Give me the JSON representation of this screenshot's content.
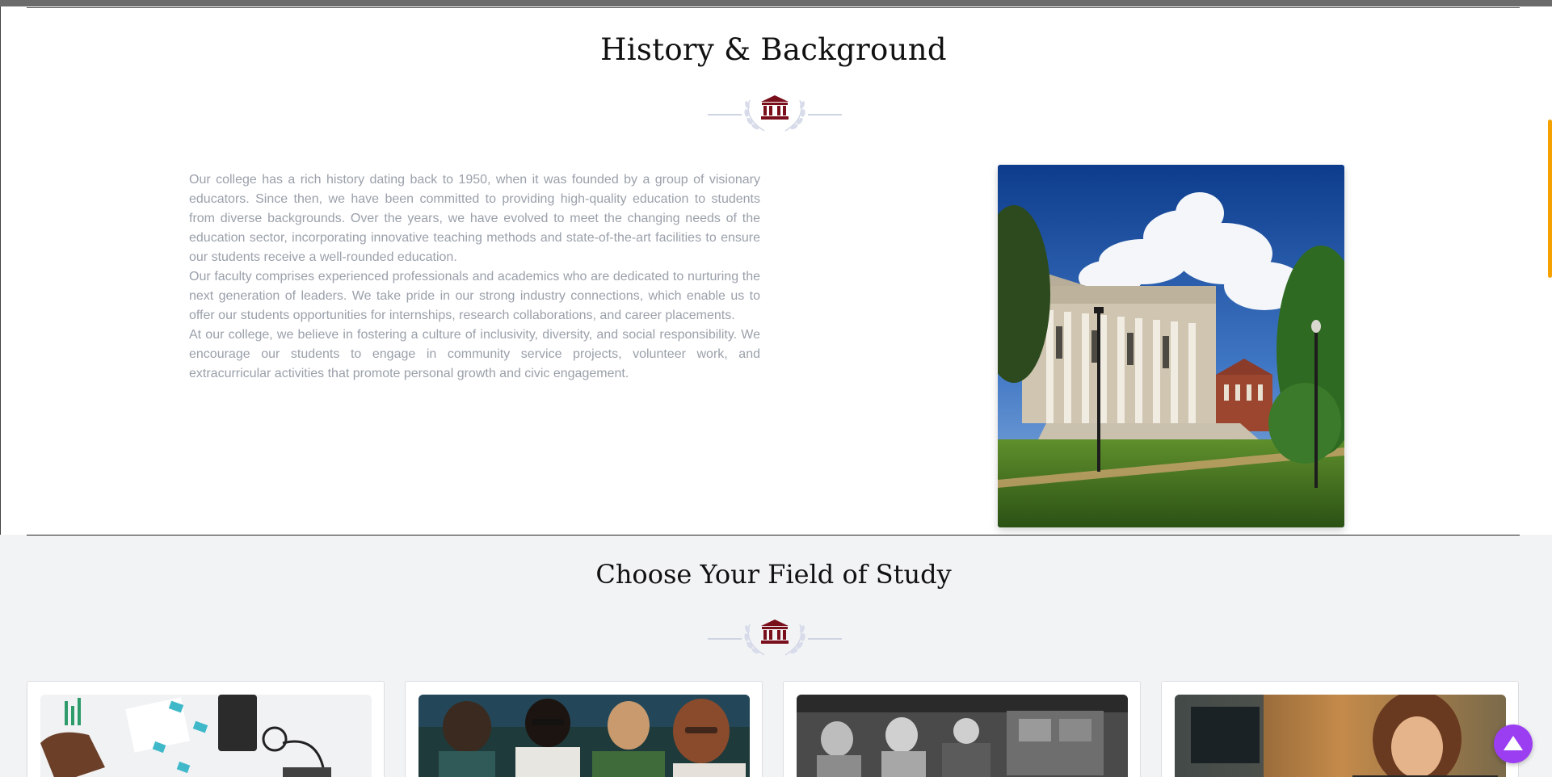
{
  "history": {
    "title": "History & Background",
    "divider_icon": "institution-icon",
    "paragraphs": [
      "Our college has a rich history dating back to 1950, when it was founded by a group of visionary educators. Since then, we have been committed to providing high-quality education to students from diverse backgrounds. Over the years, we have evolved to meet the changing needs of the education sector, incorporating innovative teaching methods and state-of-the-art facilities to ensure our students receive a well-rounded education.",
      "Our faculty comprises experienced professionals and academics who are dedicated to nurturing the next generation of leaders. We take pride in our strong industry connections, which enable us to offer our students opportunities for internships, research collaborations, and career placements.",
      "At our college, we believe in fostering a culture of inclusivity, diversity, and social responsibility. We encourage our students to engage in community service projects, volunteer work, and extracurricular activities that promote personal growth and civic engagement."
    ]
  },
  "fields": {
    "title": "Choose Your Field of Study",
    "divider_icon": "institution-icon"
  },
  "colors": {
    "accent_maroon": "#7a0f1c",
    "laurel": "#d3d7e6",
    "body_text": "#9aa0aa",
    "back_to_top": "#9b3ef2",
    "scroll_thumb": "#f5a100"
  },
  "icons": {
    "back_to_top": "triangle-up-icon"
  }
}
